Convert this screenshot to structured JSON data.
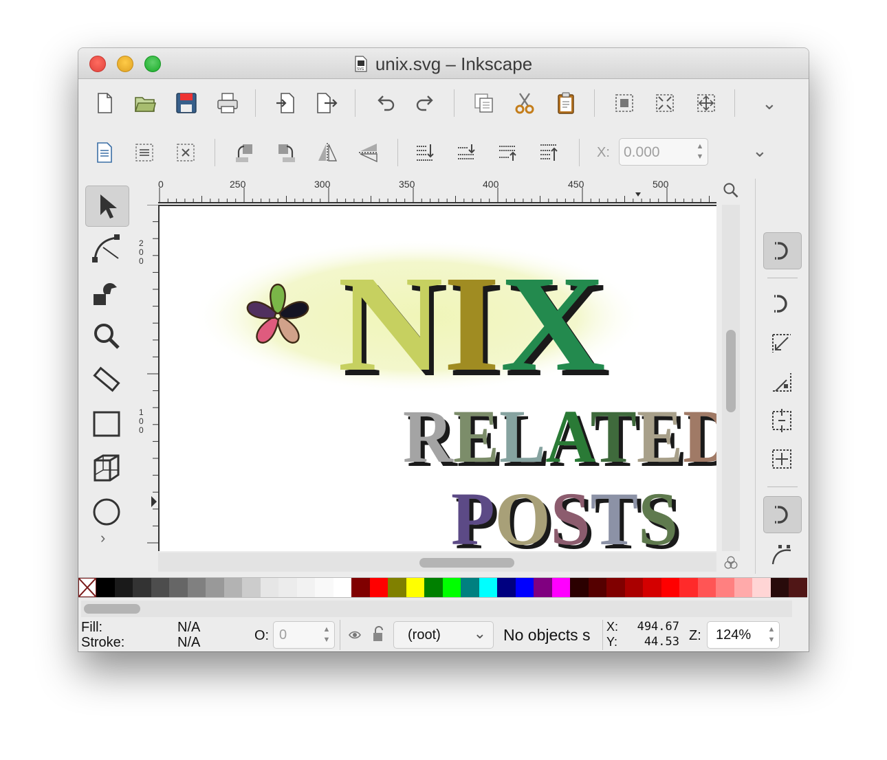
{
  "window": {
    "title": "unix.svg – Inkscape"
  },
  "toolbar_main": {
    "buttons": [
      "new-document",
      "open-file",
      "save",
      "print",
      "import",
      "export",
      "undo",
      "redo",
      "duplicate",
      "cut",
      "paste",
      "zoom-selection",
      "zoom-drawing",
      "zoom-page"
    ]
  },
  "toolbar_controls": {
    "x_label": "X:",
    "x_value": "0.000"
  },
  "ruler_top": {
    "labels": [
      "0",
      "250",
      "300",
      "350",
      "400",
      "450",
      "500"
    ]
  },
  "ruler_left": {
    "labels": [
      "2\n0\n0",
      "1\n0\n0"
    ]
  },
  "canvas": {
    "logo_text": "NIX",
    "line2": "RELATED",
    "line3": "POSTS",
    "glow_color": "#f0f5b8"
  },
  "palette": {
    "colors": [
      "#000000",
      "#1a1a1a",
      "#333333",
      "#4d4d4d",
      "#666666",
      "#808080",
      "#999999",
      "#b3b3b3",
      "#cccccc",
      "#e6e6e6",
      "#ececec",
      "#f2f2f2",
      "#f9f9f9",
      "#ffffff",
      "#800000",
      "#ff0000",
      "#808000",
      "#ffff00",
      "#008000",
      "#00ff00",
      "#008080",
      "#00ffff",
      "#000080",
      "#0000ff",
      "#800080",
      "#ff00ff",
      "#2b0000",
      "#550000",
      "#800000",
      "#aa0000",
      "#d40000",
      "#ff0000",
      "#ff2a2a",
      "#ff5555",
      "#ff8080",
      "#ffaaaa",
      "#ffd5d5",
      "#280b0b",
      "#501616"
    ]
  },
  "status": {
    "fill_label": "Fill:",
    "fill_value": "N/A",
    "stroke_label": "Stroke:",
    "stroke_value": "N/A",
    "opacity_label": "O:",
    "opacity_value": "0",
    "layer_value": "(root)",
    "message": "No objects s",
    "x_label": "X:",
    "x_value": "494.67",
    "y_label": "Y:",
    "y_value": "44.53",
    "zoom_label": "Z:",
    "zoom_value": "124%"
  }
}
